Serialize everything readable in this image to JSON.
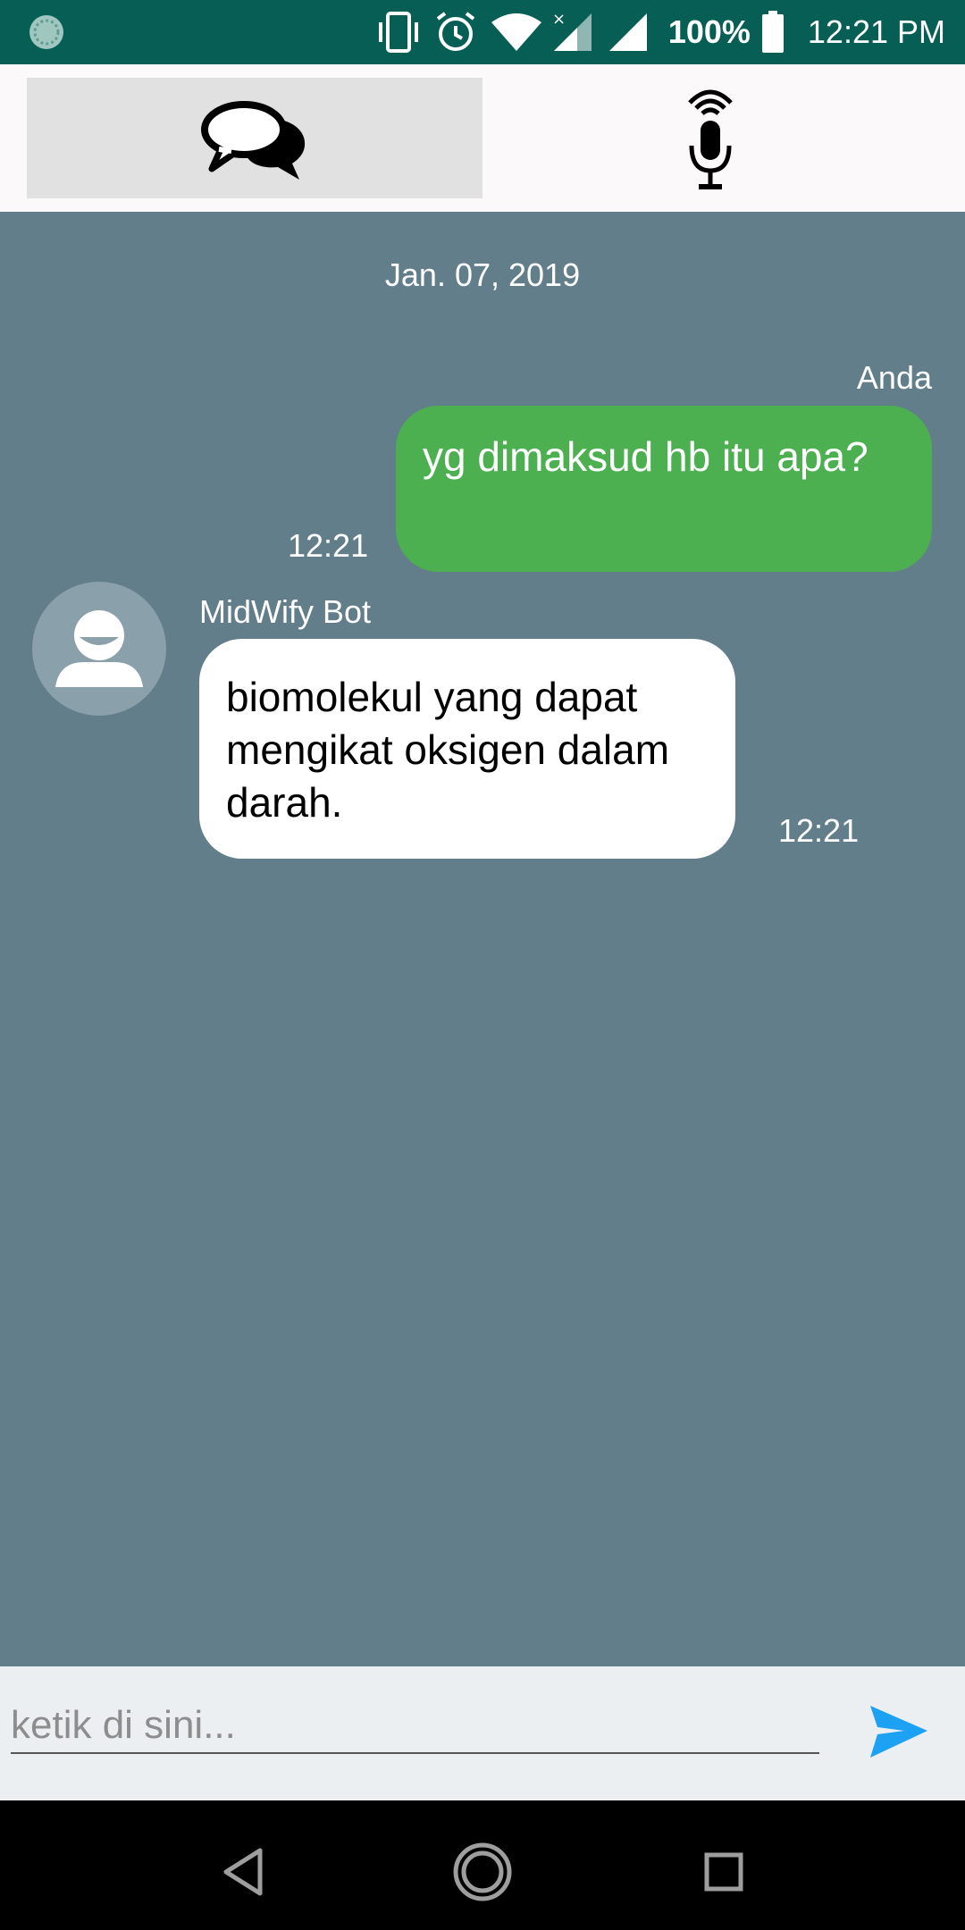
{
  "status_bar": {
    "battery": "100%",
    "time": "12:21 PM",
    "icons": [
      "app-status-icon",
      "vibrate-icon",
      "alarm-icon",
      "wifi-icon",
      "signal-no-data-icon",
      "signal-icon",
      "battery-icon"
    ]
  },
  "tabs": [
    {
      "icon": "chat-bubbles-icon",
      "active": true
    },
    {
      "icon": "microphone-icon",
      "active": false
    }
  ],
  "chat": {
    "date": "Jan. 07, 2019",
    "messages": [
      {
        "sender": "Anda",
        "text": "yg dimaksud hb itu apa?",
        "time": "12:21",
        "bubble_color": "#4caf50"
      },
      {
        "sender": "MidWify Bot",
        "text": "biomolekul yang dapat mengikat oksigen dalam darah.",
        "time": "12:21",
        "bubble_color": "#ffffff"
      }
    ]
  },
  "input": {
    "placeholder": "ketik di sini...",
    "value": ""
  },
  "colors": {
    "status_bar": "#075e54",
    "chat_background": "#627e8b",
    "send_icon": "#1da1f2"
  }
}
